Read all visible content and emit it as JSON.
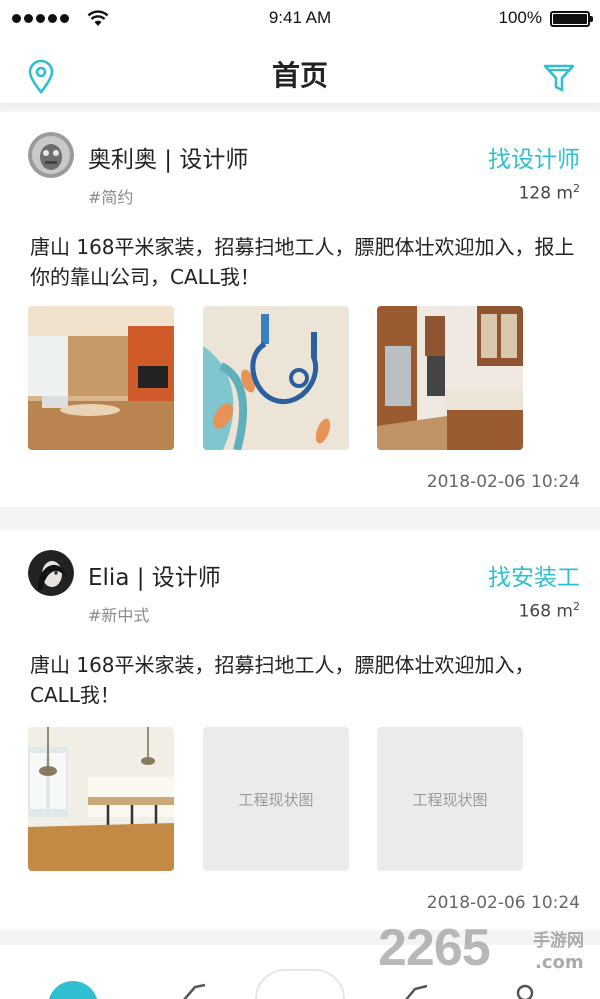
{
  "status_bar": {
    "time": "9:41 AM",
    "battery_percent": "100%",
    "battery_level": 1.0
  },
  "header": {
    "title": "首页",
    "left_icon": "location-pin-icon",
    "right_icon": "filter-funnel-icon",
    "accent_color": "#2fbfd0"
  },
  "posts": [
    {
      "name": "奥利奥 | 设计师",
      "tag": "#简约",
      "action": "找设计师",
      "area_value": "128 m",
      "area_unit_sup": "2",
      "description": "唐山 168平米家装，招募扫地工人，膘肥体壮欢迎加入，报上你的靠山公司，CALL我！",
      "timestamp": "2018-02-06 10:24"
    },
    {
      "name": "Elia | 设计师",
      "tag": "#新中式",
      "action": "找安装工",
      "area_value": "168 m",
      "area_unit_sup": "2",
      "description": "唐山 168平米家装，招募扫地工人，膘肥体壮欢迎加入，CALL我！",
      "placeholder_label": "工程现状图",
      "timestamp": "2018-02-06 10:24"
    }
  ],
  "watermark": {
    "number": "2265",
    "side_top": "手游网",
    "side_bottom": ".com"
  }
}
